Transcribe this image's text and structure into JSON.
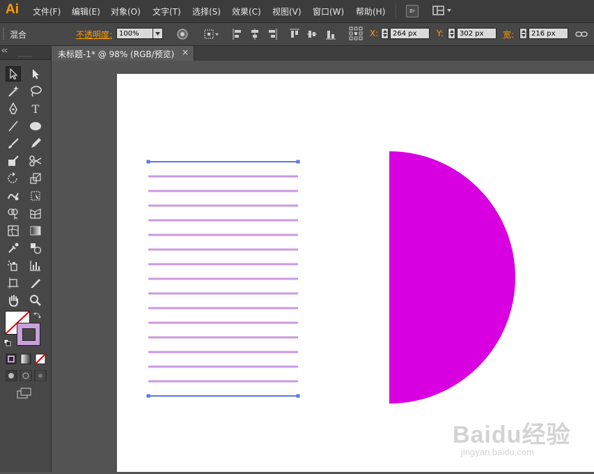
{
  "app": {
    "logo": "Ai"
  },
  "menubar": {
    "items": [
      "文件(F)",
      "编辑(E)",
      "对象(O)",
      "文字(T)",
      "选择(S)",
      "效果(C)",
      "视图(V)",
      "窗口(W)",
      "帮助(H)"
    ],
    "bridge_label": "Br"
  },
  "controlbar": {
    "mode": "混合",
    "opacity_label": "不透明度:",
    "opacity_value": "100%",
    "x_label": "X:",
    "x_value": "264 px",
    "y_label": "Y:",
    "y_value": "302 px",
    "w_label": "宽:",
    "w_value": "216 px"
  },
  "document": {
    "tab_title": "未标题-1* @ 98% (RGB/预览)",
    "close_glyph": "×"
  },
  "canvas": {
    "blend_line_color": "#cc99e0",
    "path_color": "#5577ee",
    "half_circle_color": "#d800e0",
    "blend_line_count": 16
  },
  "toolbox": {
    "fill_color": "#ffffff",
    "stroke_color": "#c9a0dc"
  },
  "watermark": {
    "main": "Baidu经验",
    "sub": "jingyan.baidu.com"
  }
}
